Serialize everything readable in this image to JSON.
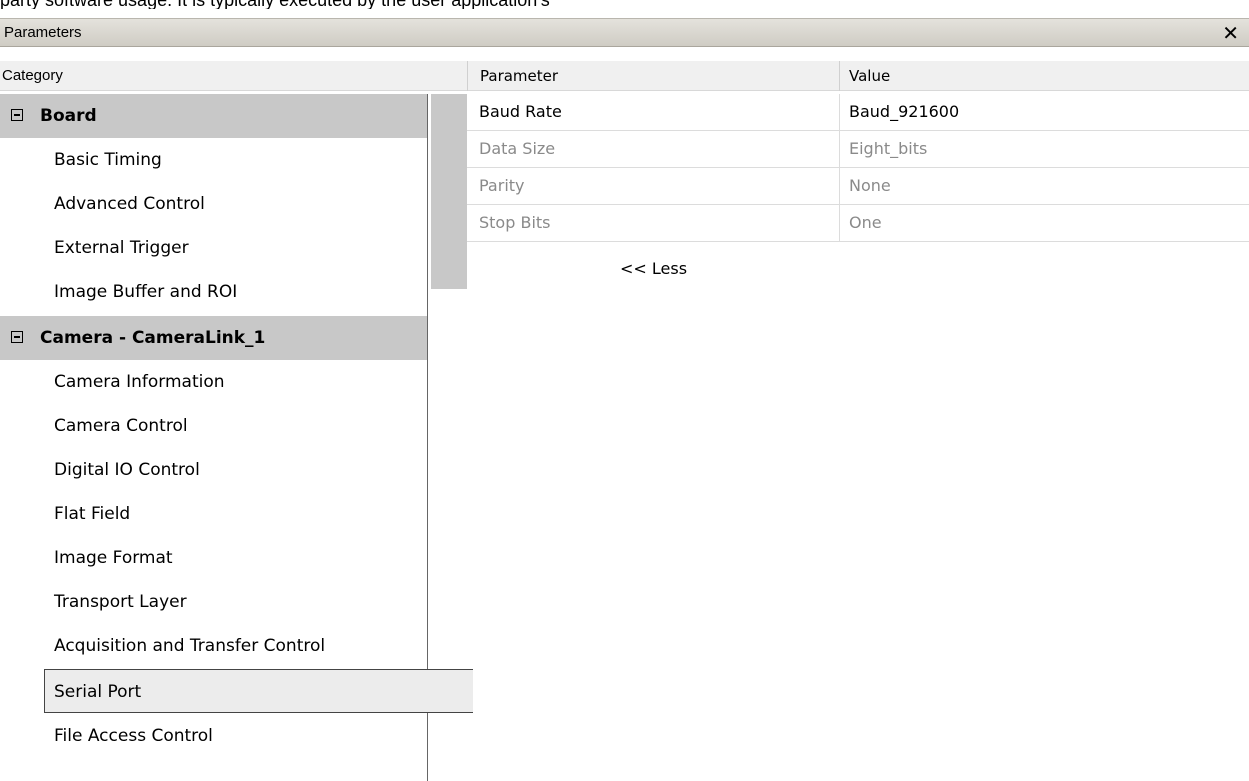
{
  "top_caption": "party software usage. It is typically executed by the user application's",
  "window": {
    "title": "Parameters",
    "close_glyph": "✕"
  },
  "header": {
    "category": "Category",
    "parameter": "Parameter",
    "value": "Value"
  },
  "categories": [
    {
      "type": "group",
      "label": "Board",
      "expanded": true
    },
    {
      "type": "item",
      "label": "Basic Timing"
    },
    {
      "type": "item",
      "label": "Advanced Control"
    },
    {
      "type": "item",
      "label": "External Trigger"
    },
    {
      "type": "item",
      "label": "Image Buffer and ROI"
    },
    {
      "type": "group",
      "label": "Camera - CameraLink_1",
      "expanded": true
    },
    {
      "type": "item",
      "label": "Camera Information"
    },
    {
      "type": "item",
      "label": "Camera Control"
    },
    {
      "type": "item",
      "label": "Digital IO Control"
    },
    {
      "type": "item",
      "label": "Flat Field"
    },
    {
      "type": "item",
      "label": "Image Format"
    },
    {
      "type": "item",
      "label": "Transport Layer"
    },
    {
      "type": "item",
      "label": "Acquisition and Transfer Control"
    },
    {
      "type": "item",
      "label": "Serial Port",
      "selected": true
    },
    {
      "type": "item",
      "label": "File Access Control"
    }
  ],
  "parameters": [
    {
      "name": "Baud Rate",
      "value": "Baud_921600",
      "enabled": true
    },
    {
      "name": "Data Size",
      "value": "Eight_bits",
      "enabled": false
    },
    {
      "name": "Parity",
      "value": "None",
      "enabled": false
    },
    {
      "name": "Stop Bits",
      "value": "One",
      "enabled": false
    }
  ],
  "less_link": "<< Less",
  "colors": {
    "group_bg": "#c8c8c8",
    "disabled_text": "#8a8a8a"
  }
}
